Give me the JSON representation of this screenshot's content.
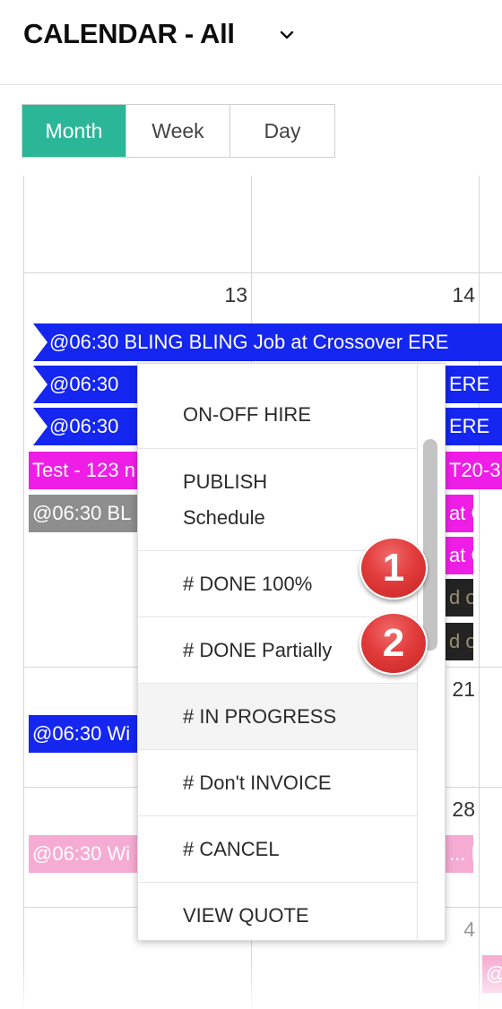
{
  "header": {
    "title": "CALENDAR - All",
    "dropdown_icon": "chevron-down-icon"
  },
  "view_toggle": {
    "buttons": [
      {
        "label": "Month",
        "active": true
      },
      {
        "label": "Week",
        "active": false
      },
      {
        "label": "Day",
        "active": false
      }
    ]
  },
  "calendar": {
    "day_numbers": [
      "13",
      "14",
      "21",
      "28",
      "4"
    ],
    "events": [
      {
        "text": "@06:30 BLING BLING Job at Crossover ERE",
        "color": "#1426ef"
      },
      {
        "text": "@06:30",
        "color": "#1426ef"
      },
      {
        "text": "ERE",
        "color": "#1426ef"
      },
      {
        "text": "@06:30",
        "color": "#1426ef"
      },
      {
        "text": "ERE",
        "color": "#1426ef"
      },
      {
        "text": "Test - 123 n",
        "color": "#ef1ee6"
      },
      {
        "text": "T20-3",
        "color": "#ef1ee6"
      },
      {
        "text": "@06:30 BL",
        "color": "#8e8e8e"
      },
      {
        "text": "at C",
        "color": "#ef1ee6"
      },
      {
        "text": "at C",
        "color": "#ef1ee6"
      },
      {
        "text": "d o",
        "color": "#232323"
      },
      {
        "text": "d o",
        "color": "#232323"
      },
      {
        "text": "@06:30 Wi",
        "color": "#1426ef"
      },
      {
        "text": "@06:30 Wi",
        "color": "#f6acd2"
      },
      {
        "text": "... E",
        "color": "#f6acd2"
      },
      {
        "text": "@",
        "color": "#f6acd2"
      }
    ]
  },
  "context_menu": {
    "items": [
      {
        "label": "ON-OFF HIRE"
      },
      {
        "label_line1": "PUBLISH",
        "label_line2": "Schedule"
      },
      {
        "label": "# DONE 100%"
      },
      {
        "label": "# DONE Partially"
      },
      {
        "label": "# IN PROGRESS"
      },
      {
        "label": "# Don't INVOICE"
      },
      {
        "label": "# CANCEL"
      },
      {
        "label": "VIEW QUOTE"
      }
    ]
  },
  "badges": [
    {
      "label": "1",
      "color": "#e23c3c"
    },
    {
      "label": "2",
      "color": "#e23c3c"
    }
  ],
  "colors": {
    "accent": "#2bb797",
    "event_blue": "#1426ef",
    "event_magenta": "#ef1ee6",
    "event_gray": "#8e8e8e",
    "event_pink": "#f6acd2",
    "badge_red": "#e23c3c"
  }
}
